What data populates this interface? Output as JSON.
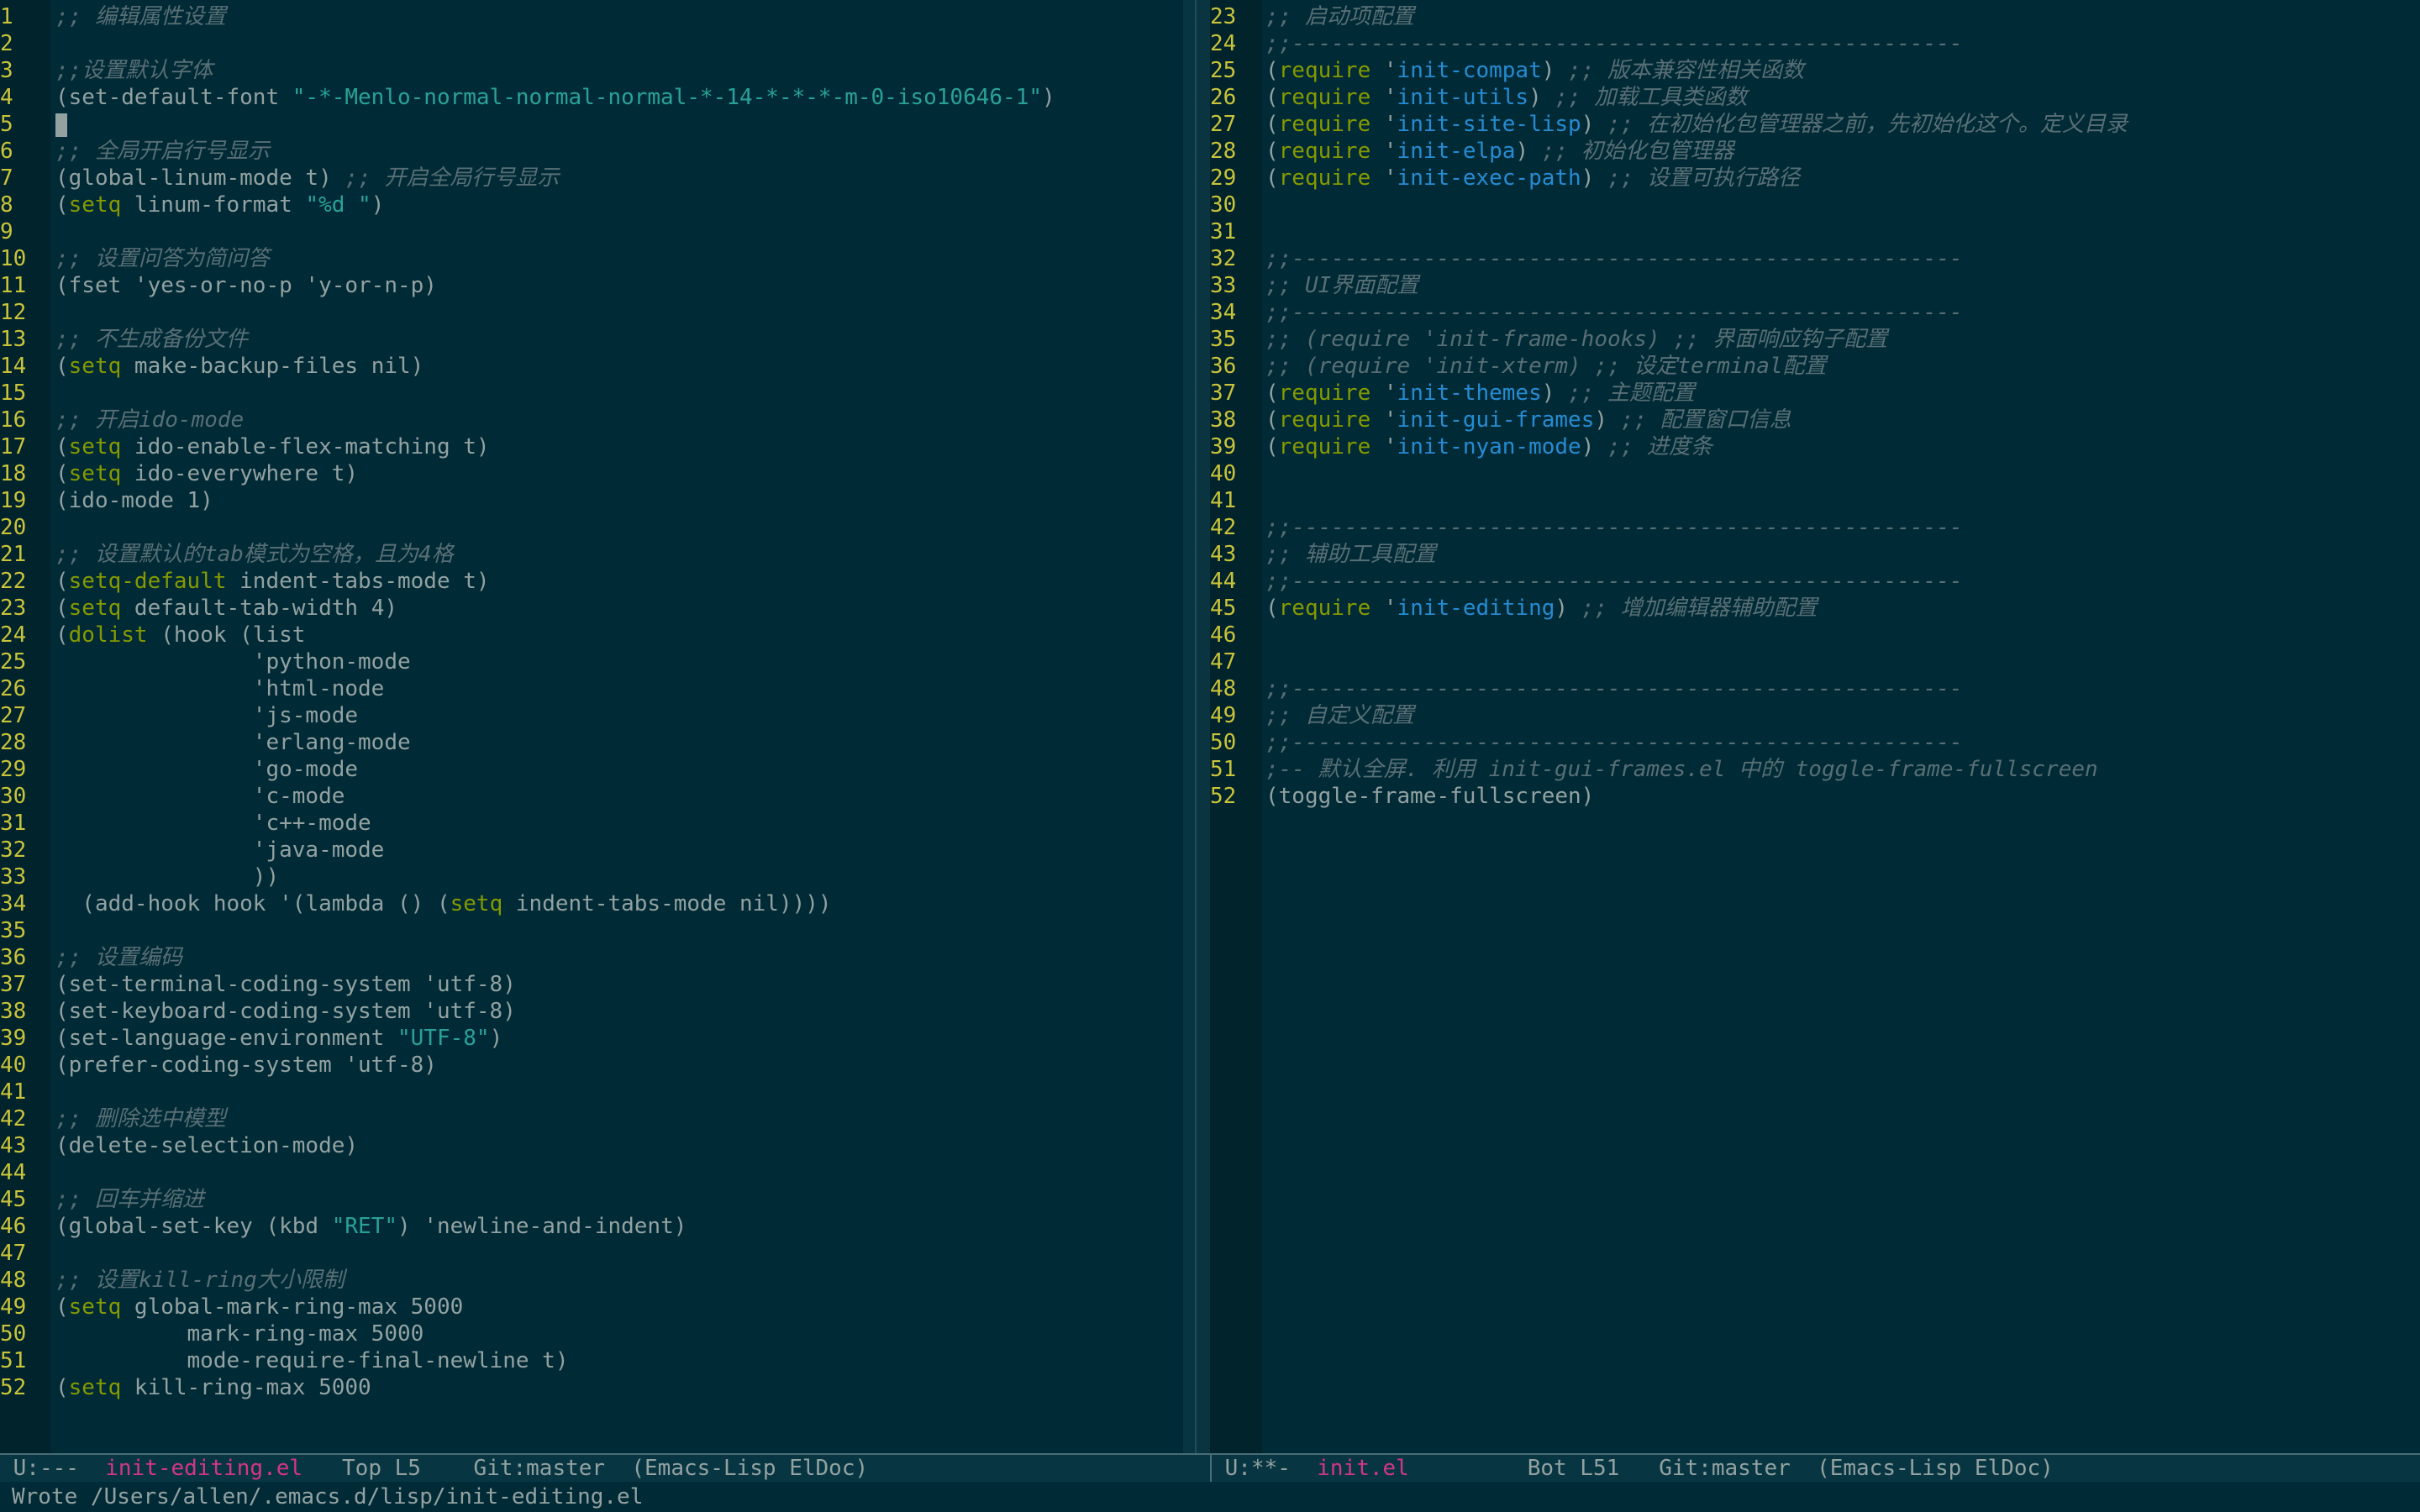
{
  "colors": {
    "background": "#002b36",
    "line_number": "#c9c33a",
    "comment": "#586e75",
    "keyword": "#859900",
    "string": "#2aa198",
    "function": "#268bd2",
    "buffer_name": "#d33682"
  },
  "left_pane": {
    "lines": [
      {
        "n": "1",
        "t": [
          {
            "c": "c",
            "v": ";; 编辑属性设置"
          }
        ]
      },
      {
        "n": "2",
        "t": []
      },
      {
        "n": "3",
        "t": [
          {
            "c": "c",
            "v": ";;设置默认字体"
          }
        ]
      },
      {
        "n": "4",
        "t": [
          {
            "c": "p",
            "v": "(set-default-font "
          },
          {
            "c": "s",
            "v": "\"-*-Menlo-normal-normal-normal-*-14-*-*-*-m-0-iso10646-1\""
          },
          {
            "c": "p",
            "v": ")"
          }
        ]
      },
      {
        "n": "5",
        "t": [],
        "cursor": true
      },
      {
        "n": "6",
        "t": [
          {
            "c": "c",
            "v": ";; 全局开启行号显示"
          }
        ]
      },
      {
        "n": "7",
        "t": [
          {
            "c": "p",
            "v": "(global-linum-mode t) "
          },
          {
            "c": "c",
            "v": ";; 开启全局行号显示"
          }
        ]
      },
      {
        "n": "8",
        "t": [
          {
            "c": "p",
            "v": "("
          },
          {
            "c": "k",
            "v": "setq"
          },
          {
            "c": "p",
            "v": " linum-format "
          },
          {
            "c": "s",
            "v": "\"%d \""
          },
          {
            "c": "p",
            "v": ")"
          }
        ]
      },
      {
        "n": "9",
        "t": []
      },
      {
        "n": "10",
        "t": [
          {
            "c": "c",
            "v": ";; 设置问答为简问答"
          }
        ]
      },
      {
        "n": "11",
        "t": [
          {
            "c": "p",
            "v": "(fset 'yes-or-no-p 'y-or-n-p)"
          }
        ]
      },
      {
        "n": "12",
        "t": []
      },
      {
        "n": "13",
        "t": [
          {
            "c": "c",
            "v": ";; 不生成备份文件"
          }
        ]
      },
      {
        "n": "14",
        "t": [
          {
            "c": "p",
            "v": "("
          },
          {
            "c": "k",
            "v": "setq"
          },
          {
            "c": "p",
            "v": " make-backup-files nil)"
          }
        ]
      },
      {
        "n": "15",
        "t": []
      },
      {
        "n": "16",
        "t": [
          {
            "c": "c",
            "v": ";; 开启ido-mode"
          }
        ]
      },
      {
        "n": "17",
        "t": [
          {
            "c": "p",
            "v": "("
          },
          {
            "c": "k",
            "v": "setq"
          },
          {
            "c": "p",
            "v": " ido-enable-flex-matching t)"
          }
        ]
      },
      {
        "n": "18",
        "t": [
          {
            "c": "p",
            "v": "("
          },
          {
            "c": "k",
            "v": "setq"
          },
          {
            "c": "p",
            "v": " ido-everywhere t)"
          }
        ]
      },
      {
        "n": "19",
        "t": [
          {
            "c": "p",
            "v": "(ido-mode 1)"
          }
        ]
      },
      {
        "n": "20",
        "t": []
      },
      {
        "n": "21",
        "t": [
          {
            "c": "c",
            "v": ";; 设置默认的tab模式为空格，且为4格"
          }
        ]
      },
      {
        "n": "22",
        "t": [
          {
            "c": "p",
            "v": "("
          },
          {
            "c": "k",
            "v": "setq-default"
          },
          {
            "c": "p",
            "v": " indent-tabs-mode t)"
          }
        ]
      },
      {
        "n": "23",
        "t": [
          {
            "c": "p",
            "v": "("
          },
          {
            "c": "k",
            "v": "setq"
          },
          {
            "c": "p",
            "v": " default-tab-width 4)"
          }
        ]
      },
      {
        "n": "24",
        "t": [
          {
            "c": "p",
            "v": "("
          },
          {
            "c": "k",
            "v": "dolist"
          },
          {
            "c": "p",
            "v": " (hook (list"
          }
        ]
      },
      {
        "n": "25",
        "t": [
          {
            "c": "p",
            "v": "               'python-mode"
          }
        ]
      },
      {
        "n": "26",
        "t": [
          {
            "c": "p",
            "v": "               'html-node"
          }
        ]
      },
      {
        "n": "27",
        "t": [
          {
            "c": "p",
            "v": "               'js-mode"
          }
        ]
      },
      {
        "n": "28",
        "t": [
          {
            "c": "p",
            "v": "               'erlang-mode"
          }
        ]
      },
      {
        "n": "29",
        "t": [
          {
            "c": "p",
            "v": "               'go-mode"
          }
        ]
      },
      {
        "n": "30",
        "t": [
          {
            "c": "p",
            "v": "               'c-mode"
          }
        ]
      },
      {
        "n": "31",
        "t": [
          {
            "c": "p",
            "v": "               'c++-mode"
          }
        ]
      },
      {
        "n": "32",
        "t": [
          {
            "c": "p",
            "v": "               'java-mode"
          }
        ]
      },
      {
        "n": "33",
        "t": [
          {
            "c": "p",
            "v": "               ))"
          }
        ]
      },
      {
        "n": "34",
        "t": [
          {
            "c": "p",
            "v": "  (add-hook hook '(lambda () ("
          },
          {
            "c": "k",
            "v": "setq"
          },
          {
            "c": "p",
            "v": " indent-tabs-mode nil))))"
          }
        ]
      },
      {
        "n": "35",
        "t": []
      },
      {
        "n": "36",
        "t": [
          {
            "c": "c",
            "v": ";; 设置编码"
          }
        ]
      },
      {
        "n": "37",
        "t": [
          {
            "c": "p",
            "v": "(set-terminal-coding-system 'utf-8)"
          }
        ]
      },
      {
        "n": "38",
        "t": [
          {
            "c": "p",
            "v": "(set-keyboard-coding-system 'utf-8)"
          }
        ]
      },
      {
        "n": "39",
        "t": [
          {
            "c": "p",
            "v": "(set-language-environment "
          },
          {
            "c": "s",
            "v": "\"UTF-8\""
          },
          {
            "c": "p",
            "v": ")"
          }
        ]
      },
      {
        "n": "40",
        "t": [
          {
            "c": "p",
            "v": "(prefer-coding-system 'utf-8)"
          }
        ]
      },
      {
        "n": "41",
        "t": []
      },
      {
        "n": "42",
        "t": [
          {
            "c": "c",
            "v": ";; 删除选中模型"
          }
        ]
      },
      {
        "n": "43",
        "t": [
          {
            "c": "p",
            "v": "(delete-selection-mode)"
          }
        ]
      },
      {
        "n": "44",
        "t": []
      },
      {
        "n": "45",
        "t": [
          {
            "c": "c",
            "v": ";; 回车并缩进"
          }
        ]
      },
      {
        "n": "46",
        "t": [
          {
            "c": "p",
            "v": "(global-set-key (kbd "
          },
          {
            "c": "s",
            "v": "\"RET\""
          },
          {
            "c": "p",
            "v": ") 'newline-and-indent)"
          }
        ]
      },
      {
        "n": "47",
        "t": []
      },
      {
        "n": "48",
        "t": [
          {
            "c": "c",
            "v": ";; 设置kill-ring大小限制"
          }
        ]
      },
      {
        "n": "49",
        "t": [
          {
            "c": "p",
            "v": "("
          },
          {
            "c": "k",
            "v": "setq"
          },
          {
            "c": "p",
            "v": " global-mark-ring-max 5000"
          }
        ]
      },
      {
        "n": "50",
        "t": [
          {
            "c": "p",
            "v": "          mark-ring-max 5000"
          }
        ]
      },
      {
        "n": "51",
        "t": [
          {
            "c": "p",
            "v": "          mode-require-final-newline t)"
          }
        ]
      },
      {
        "n": "52",
        "t": [
          {
            "c": "p",
            "v": "("
          },
          {
            "c": "k",
            "v": "setq"
          },
          {
            "c": "p",
            "v": " kill-ring-max 5000"
          }
        ]
      }
    ]
  },
  "right_pane": {
    "lines": [
      {
        "n": "23",
        "t": [
          {
            "c": "c",
            "v": ";; 启动项配置"
          }
        ]
      },
      {
        "n": "24",
        "t": [
          {
            "c": "c",
            "v": ";;---------------------------------------------------"
          }
        ]
      },
      {
        "n": "25",
        "t": [
          {
            "c": "p",
            "v": "("
          },
          {
            "c": "k",
            "v": "require"
          },
          {
            "c": "p",
            "v": " '"
          },
          {
            "c": "f",
            "v": "init-compat"
          },
          {
            "c": "p",
            "v": ") "
          },
          {
            "c": "c",
            "v": ";; 版本兼容性相关函数"
          }
        ]
      },
      {
        "n": "26",
        "t": [
          {
            "c": "p",
            "v": "("
          },
          {
            "c": "k",
            "v": "require"
          },
          {
            "c": "p",
            "v": " '"
          },
          {
            "c": "f",
            "v": "init-utils"
          },
          {
            "c": "p",
            "v": ") "
          },
          {
            "c": "c",
            "v": ";; 加载工具类函数"
          }
        ]
      },
      {
        "n": "27",
        "t": [
          {
            "c": "p",
            "v": "("
          },
          {
            "c": "k",
            "v": "require"
          },
          {
            "c": "p",
            "v": " '"
          },
          {
            "c": "f",
            "v": "init-site-lisp"
          },
          {
            "c": "p",
            "v": ") "
          },
          {
            "c": "c",
            "v": ";; 在初始化包管理器之前，先初始化这个。定义目录"
          }
        ]
      },
      {
        "n": "28",
        "t": [
          {
            "c": "p",
            "v": "("
          },
          {
            "c": "k",
            "v": "require"
          },
          {
            "c": "p",
            "v": " '"
          },
          {
            "c": "f",
            "v": "init-elpa"
          },
          {
            "c": "p",
            "v": ") "
          },
          {
            "c": "c",
            "v": ";; 初始化包管理器"
          }
        ]
      },
      {
        "n": "29",
        "t": [
          {
            "c": "p",
            "v": "("
          },
          {
            "c": "k",
            "v": "require"
          },
          {
            "c": "p",
            "v": " '"
          },
          {
            "c": "f",
            "v": "init-exec-path"
          },
          {
            "c": "p",
            "v": ") "
          },
          {
            "c": "c",
            "v": ";; 设置可执行路径"
          }
        ]
      },
      {
        "n": "30",
        "t": []
      },
      {
        "n": "31",
        "t": []
      },
      {
        "n": "32",
        "t": [
          {
            "c": "c",
            "v": ";;---------------------------------------------------"
          }
        ]
      },
      {
        "n": "33",
        "t": [
          {
            "c": "c",
            "v": ";; UI界面配置"
          }
        ]
      },
      {
        "n": "34",
        "t": [
          {
            "c": "c",
            "v": ";;---------------------------------------------------"
          }
        ]
      },
      {
        "n": "35",
        "t": [
          {
            "c": "c",
            "v": ";; (require 'init-frame-hooks) ;; 界面响应钩子配置"
          }
        ]
      },
      {
        "n": "36",
        "t": [
          {
            "c": "c",
            "v": ";; (require 'init-xterm) ;; 设定terminal配置"
          }
        ]
      },
      {
        "n": "37",
        "t": [
          {
            "c": "p",
            "v": "("
          },
          {
            "c": "k",
            "v": "require"
          },
          {
            "c": "p",
            "v": " '"
          },
          {
            "c": "f",
            "v": "init-themes"
          },
          {
            "c": "p",
            "v": ") "
          },
          {
            "c": "c",
            "v": ";; 主题配置"
          }
        ]
      },
      {
        "n": "38",
        "t": [
          {
            "c": "p",
            "v": "("
          },
          {
            "c": "k",
            "v": "require"
          },
          {
            "c": "p",
            "v": " '"
          },
          {
            "c": "f",
            "v": "init-gui-frames"
          },
          {
            "c": "p",
            "v": ") "
          },
          {
            "c": "c",
            "v": ";; 配置窗口信息"
          }
        ]
      },
      {
        "n": "39",
        "t": [
          {
            "c": "p",
            "v": "("
          },
          {
            "c": "k",
            "v": "require"
          },
          {
            "c": "p",
            "v": " '"
          },
          {
            "c": "f",
            "v": "init-nyan-mode"
          },
          {
            "c": "p",
            "v": ") "
          },
          {
            "c": "c",
            "v": ";; 进度条"
          }
        ]
      },
      {
        "n": "40",
        "t": []
      },
      {
        "n": "41",
        "t": []
      },
      {
        "n": "42",
        "t": [
          {
            "c": "c",
            "v": ";;---------------------------------------------------"
          }
        ]
      },
      {
        "n": "43",
        "t": [
          {
            "c": "c",
            "v": ";; 辅助工具配置"
          }
        ]
      },
      {
        "n": "44",
        "t": [
          {
            "c": "c",
            "v": ";;---------------------------------------------------"
          }
        ]
      },
      {
        "n": "45",
        "t": [
          {
            "c": "p",
            "v": "("
          },
          {
            "c": "k",
            "v": "require"
          },
          {
            "c": "p",
            "v": " '"
          },
          {
            "c": "f",
            "v": "init-editing"
          },
          {
            "c": "p",
            "v": ") "
          },
          {
            "c": "c",
            "v": ";; 增加编辑器辅助配置"
          }
        ]
      },
      {
        "n": "46",
        "t": []
      },
      {
        "n": "47",
        "t": []
      },
      {
        "n": "48",
        "t": [
          {
            "c": "c",
            "v": ";;---------------------------------------------------"
          }
        ]
      },
      {
        "n": "49",
        "t": [
          {
            "c": "c",
            "v": ";; 自定义配置"
          }
        ]
      },
      {
        "n": "50",
        "t": [
          {
            "c": "c",
            "v": ";;---------------------------------------------------"
          }
        ]
      },
      {
        "n": "51",
        "t": [
          {
            "c": "c",
            "v": ";-- 默认全屏. 利用 init-gui-frames.el 中的 toggle-frame-fullscreen"
          }
        ]
      },
      {
        "n": "52",
        "t": [
          {
            "c": "p",
            "v": "(toggle-frame-fullscreen)"
          }
        ]
      }
    ]
  },
  "modeline_left": {
    "status": " U:---  ",
    "buffer": "init-editing.el",
    "rest": "   Top L5    Git:master  (Emacs-Lisp ElDoc)"
  },
  "modeline_right": {
    "status": " U:**-  ",
    "buffer": "init.el",
    "rest": "         Bot L51   Git:master  (Emacs-Lisp ElDoc)"
  },
  "echo_area": {
    "message": "Wrote /Users/allen/.emacs.d/lisp/init-editing.el"
  }
}
